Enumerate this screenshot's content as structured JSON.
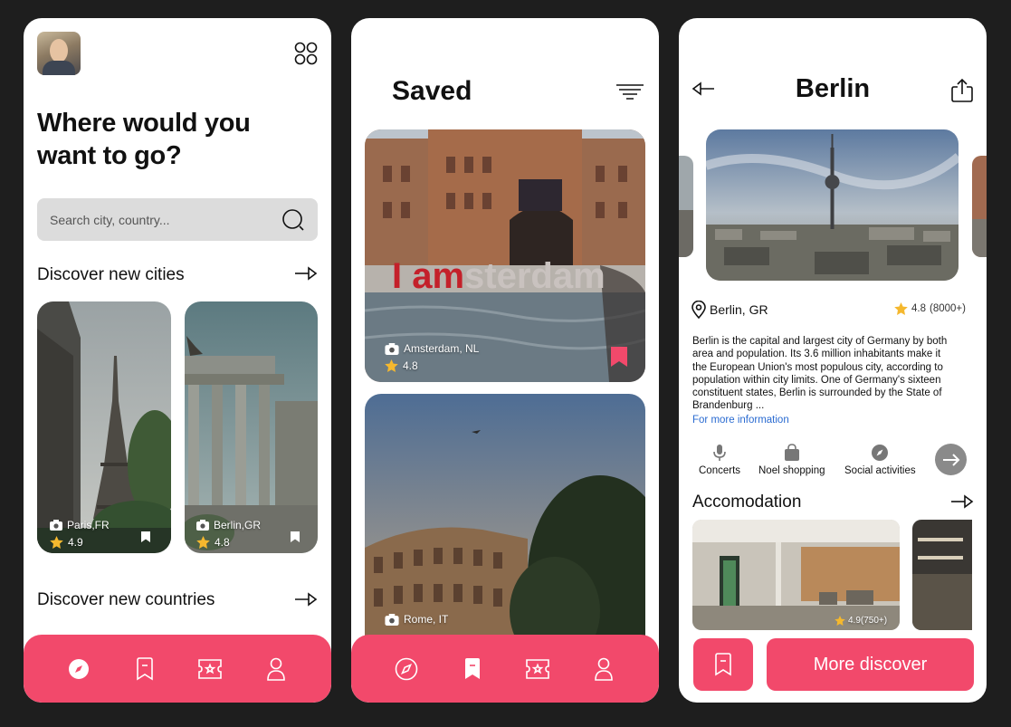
{
  "colors": {
    "accent": "#f2496b",
    "background": "#1e1e1e",
    "card": "#ffffff",
    "link": "#2a6bd1",
    "star": "#f5b82e"
  },
  "home": {
    "headline": "Where would you want to go?",
    "search_placeholder": "Search city, country...",
    "section_cities": "Discover new cities",
    "section_countries": "Discover new countries",
    "cities": [
      {
        "name": "Paris,FR",
        "rating": "4.9"
      },
      {
        "name": "Berlin,GR",
        "rating": "4.8"
      }
    ]
  },
  "saved": {
    "title": "Saved",
    "items": [
      {
        "name": "Amsterdam, NL",
        "rating": "4.8",
        "sign": "I amsterdam"
      },
      {
        "name": "Rome, IT"
      }
    ]
  },
  "detail": {
    "title": "Berlin",
    "location": "Berlin, GR",
    "rating": "4.8",
    "reviews": "(8000+)",
    "description": "Berlin is the capital and largest city of Germany by both area and population. Its 3.6 million inhabitants make it the European Union's most populous city, according to population within city limits. One of Germany's sixteen constituent states, Berlin is surrounded by the State of Brandenburg ...",
    "more_link": "For more information",
    "activities": [
      "Concerts",
      "Noel shopping",
      "Social activities"
    ],
    "accomodation_title": "Accomodation",
    "accomodation_rating": "4.9(750+)",
    "more_button": "More discover"
  },
  "nav": {
    "icons": [
      "compass-icon",
      "bookmark-icon",
      "ticket-icon",
      "profile-icon"
    ]
  }
}
